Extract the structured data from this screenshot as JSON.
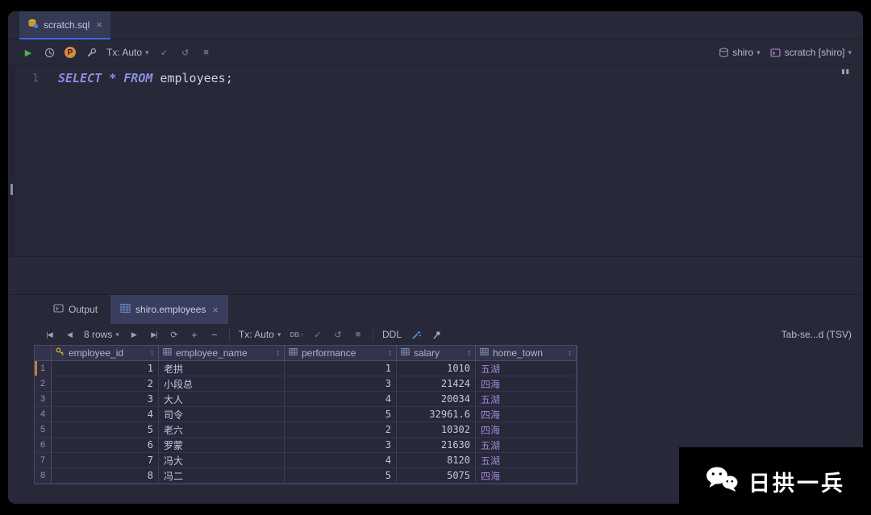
{
  "colors": {
    "accent_blue": "#3d6ae0",
    "run_green": "#4fae53",
    "keyword_purple": "#8a8de6",
    "grid_line_purple": "#4c4770",
    "home_town_purple": "#a284d8",
    "primary_key_gold": "#d6a63c",
    "current_row_marker_orange": "#c87a3c"
  },
  "editor_tabbar": {
    "tab": {
      "label": "scratch.sql"
    }
  },
  "editor_toolbar": {
    "tx": "Tx: Auto",
    "db_target": "shiro",
    "session_target": "scratch [shiro]"
  },
  "editor": {
    "line_number": "1",
    "code_keywords": "SELECT * FROM",
    "code_plain": " employees;"
  },
  "tool_window": {
    "tabs": [
      {
        "label": "Output"
      },
      {
        "label": "shiro.employees"
      }
    ]
  },
  "results_toolbar": {
    "rows_count": "8 rows",
    "tx": "Tx: Auto",
    "submit": "DB",
    "ddl": "DDL",
    "export_format": "Tab-se...d (TSV)"
  },
  "results_table": {
    "columns": [
      {
        "name": "employee_id",
        "icon": "key",
        "cls": "num"
      },
      {
        "name": "employee_name",
        "icon": "grid",
        "cls": "name"
      },
      {
        "name": "performance",
        "icon": "grid",
        "cls": "num"
      },
      {
        "name": "salary",
        "icon": "grid",
        "cls": "num"
      },
      {
        "name": "home_town",
        "icon": "grid",
        "cls": "town"
      }
    ],
    "rows": [
      [
        "1",
        "1",
        "老拱",
        "1",
        "1010",
        "五湖"
      ],
      [
        "2",
        "2",
        "小段总",
        "3",
        "21424",
        "四海"
      ],
      [
        "3",
        "3",
        "大人",
        "4",
        "20034",
        "五湖"
      ],
      [
        "4",
        "4",
        "司令",
        "5",
        "32961.6",
        "四海"
      ],
      [
        "5",
        "5",
        "老六",
        "2",
        "10302",
        "四海"
      ],
      [
        "6",
        "6",
        "罗蒙",
        "3",
        "21630",
        "五湖"
      ],
      [
        "7",
        "7",
        "冯大",
        "4",
        "8120",
        "五湖"
      ],
      [
        "8",
        "8",
        "冯二",
        "5",
        "5075",
        "四海"
      ]
    ]
  },
  "watermark": {
    "brand": "日拱一兵"
  },
  "icons": {
    "close": "×",
    "run": "▶",
    "check": "✓",
    "rollback": "↺",
    "stop": "■",
    "chevron": "▾",
    "first": "|◀",
    "prev": "◀",
    "next": "▶",
    "last": "▶|",
    "refresh": "⟳",
    "plus": "+",
    "minus": "−",
    "sort": "↕",
    "p_badge": "P",
    "db_arrow": "↑",
    "caret_marker": "▮▮"
  }
}
